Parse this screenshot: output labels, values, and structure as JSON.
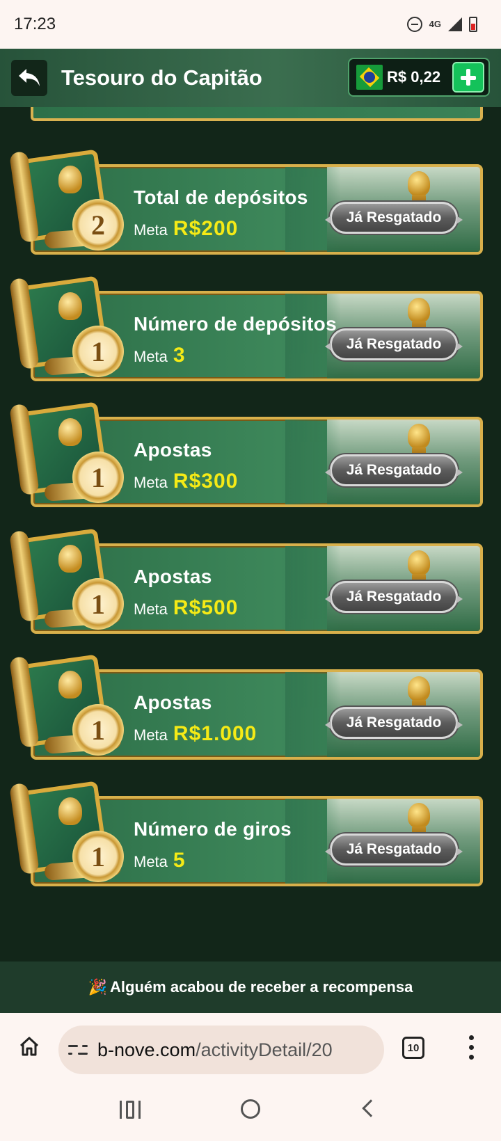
{
  "status_bar": {
    "time": "17:23",
    "network": "4G",
    "icons": [
      "dnd-icon",
      "signal-icon",
      "battery-icon"
    ]
  },
  "header": {
    "title": "Tesouro do Capitão",
    "balance": "R$ 0,22",
    "flag": "brazil-flag-icon",
    "back_icon": "back-arrow-icon",
    "add_icon": "plus-icon"
  },
  "tasks": [
    {
      "rank": "2",
      "title": "Total de depósitos",
      "meta_label": "Meta",
      "meta_value": "R$200",
      "status": "Já Resgatado"
    },
    {
      "rank": "1",
      "title": "Número de depósitos",
      "meta_label": "Meta",
      "meta_value": "3",
      "status": "Já Resgatado"
    },
    {
      "rank": "1",
      "title": "Apostas",
      "meta_label": "Meta",
      "meta_value": "R$300",
      "status": "Já Resgatado"
    },
    {
      "rank": "1",
      "title": "Apostas",
      "meta_label": "Meta",
      "meta_value": "R$500",
      "status": "Já Resgatado"
    },
    {
      "rank": "1",
      "title": "Apostas",
      "meta_label": "Meta",
      "meta_value": "R$1.000",
      "status": "Já Resgatado"
    },
    {
      "rank": "1",
      "title": "Número de giros",
      "meta_label": "Meta",
      "meta_value": "5",
      "status": "Já Resgatado"
    }
  ],
  "notice": {
    "icon": "🎉",
    "text": "Alguém acabou de receber a recompensa"
  },
  "browser": {
    "url_domain": "b-nove.com",
    "url_path": "/activityDetail/20",
    "tab_count": "10"
  },
  "colors": {
    "background": "#122619",
    "header": "#2f5f42",
    "card_green": "#2c6d47",
    "gold": "#d8b04b",
    "meta_yellow": "#f5ea16",
    "add_green": "#14c25a"
  }
}
